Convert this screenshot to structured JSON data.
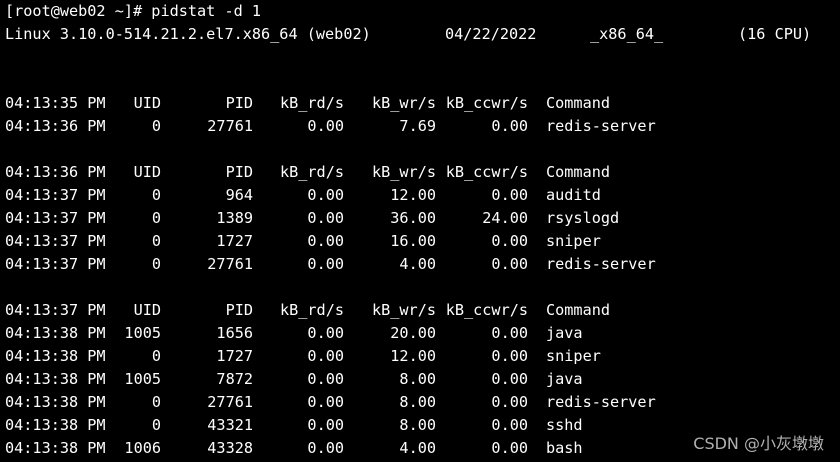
{
  "prompt_line": "[root@web02 ~]# pidstat -d 1",
  "sysinfo": {
    "kernel": "Linux 3.10.0-514.21.2.el7.x86_64 (web02)",
    "date": "04/22/2022",
    "arch": "_x86_64_",
    "cpu": "(16 CPU)"
  },
  "headers": {
    "uid": "UID",
    "pid": "PID",
    "rd": "kB_rd/s",
    "wr": "kB_wr/s",
    "ccwr": "kB_ccwr/s",
    "cmd": "Command"
  },
  "blocks": [
    {
      "header_time": "04:13:35 PM",
      "rows": [
        {
          "time": "04:13:36 PM",
          "uid": "0",
          "pid": "27761",
          "rd": "0.00",
          "wr": "7.69",
          "ccwr": "0.00",
          "cmd": "redis-server"
        }
      ]
    },
    {
      "header_time": "04:13:36 PM",
      "rows": [
        {
          "time": "04:13:37 PM",
          "uid": "0",
          "pid": "964",
          "rd": "0.00",
          "wr": "12.00",
          "ccwr": "0.00",
          "cmd": "auditd"
        },
        {
          "time": "04:13:37 PM",
          "uid": "0",
          "pid": "1389",
          "rd": "0.00",
          "wr": "36.00",
          "ccwr": "24.00",
          "cmd": "rsyslogd"
        },
        {
          "time": "04:13:37 PM",
          "uid": "0",
          "pid": "1727",
          "rd": "0.00",
          "wr": "16.00",
          "ccwr": "0.00",
          "cmd": "sniper"
        },
        {
          "time": "04:13:37 PM",
          "uid": "0",
          "pid": "27761",
          "rd": "0.00",
          "wr": "4.00",
          "ccwr": "0.00",
          "cmd": "redis-server"
        }
      ]
    },
    {
      "header_time": "04:13:37 PM",
      "rows": [
        {
          "time": "04:13:38 PM",
          "uid": "1005",
          "pid": "1656",
          "rd": "0.00",
          "wr": "20.00",
          "ccwr": "0.00",
          "cmd": "java"
        },
        {
          "time": "04:13:38 PM",
          "uid": "0",
          "pid": "1727",
          "rd": "0.00",
          "wr": "12.00",
          "ccwr": "0.00",
          "cmd": "sniper"
        },
        {
          "time": "04:13:38 PM",
          "uid": "1005",
          "pid": "7872",
          "rd": "0.00",
          "wr": "8.00",
          "ccwr": "0.00",
          "cmd": "java"
        },
        {
          "time": "04:13:38 PM",
          "uid": "0",
          "pid": "27761",
          "rd": "0.00",
          "wr": "8.00",
          "ccwr": "0.00",
          "cmd": "redis-server"
        },
        {
          "time": "04:13:38 PM",
          "uid": "0",
          "pid": "43321",
          "rd": "0.00",
          "wr": "8.00",
          "ccwr": "0.00",
          "cmd": "sshd"
        },
        {
          "time": "04:13:38 PM",
          "uid": "1006",
          "pid": "43328",
          "rd": "0.00",
          "wr": "4.00",
          "ccwr": "0.00",
          "cmd": "bash"
        }
      ]
    }
  ],
  "watermark": "CSDN @小灰墩墩",
  "colors": {
    "background": "#000000",
    "foreground": "#ffffff"
  }
}
